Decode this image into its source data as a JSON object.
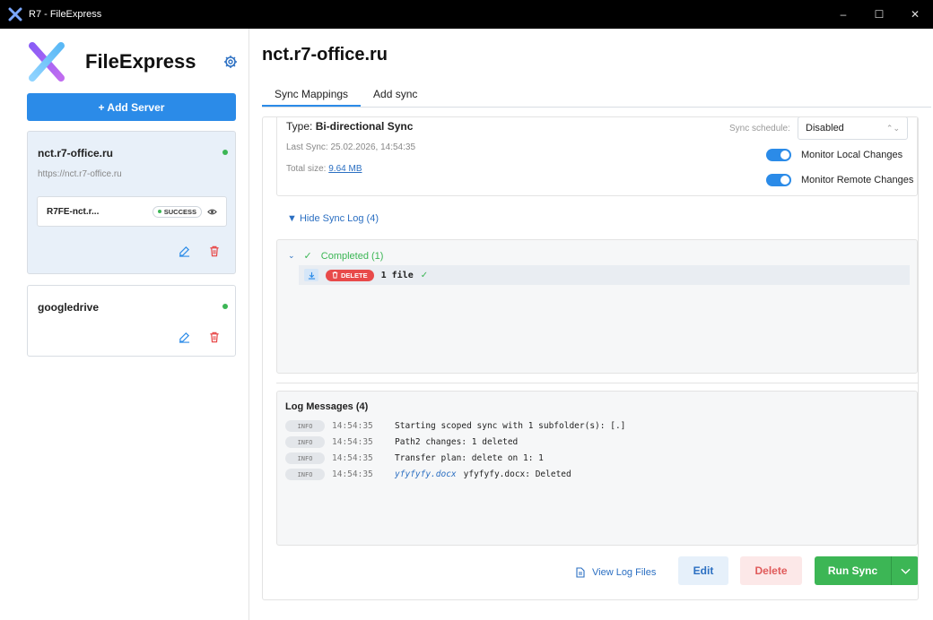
{
  "window": {
    "title": "R7 - FileExpress",
    "minimize": "–",
    "maximize": "☐",
    "close": "✕"
  },
  "sidebar": {
    "brand": "FileExpress",
    "add_server_label": "+ Add Server",
    "servers": [
      {
        "name": "nct.r7-office.ru",
        "url": "https://nct.r7-office.ru",
        "status_color": "#3cb655",
        "mapping": {
          "name": "R7FE-nct.r...",
          "status": "SUCCESS"
        }
      },
      {
        "name": "googledrive",
        "status_color": "#3cb655"
      }
    ]
  },
  "main": {
    "server_title": "nct.r7-office.ru",
    "tabs": [
      {
        "label": "Sync Mappings",
        "active": true
      },
      {
        "label": "Add sync",
        "active": false
      }
    ],
    "info": {
      "type_label": "Type: ",
      "type_value": "Bi-directional Sync",
      "last_sync": "Last Sync: 25.02.2026, 14:54:35",
      "size_label": "Total size: ",
      "size_value": "9.64 MB",
      "schedule_label": "Sync schedule:",
      "schedule_value": "Disabled",
      "monitor_local": "Monitor Local Changes",
      "monitor_remote": "Monitor Remote Changes",
      "monitor_local_on": true,
      "monitor_remote_on": true
    },
    "hide_log_label": "▼ Hide Sync Log (4)",
    "log_tree": {
      "group_label": "Completed (1)",
      "item": {
        "action": "DELETE",
        "text": "1 file"
      }
    },
    "log_messages": {
      "title": "Log Messages (4)",
      "lines": [
        {
          "level": "INFO",
          "time": "14:54:35",
          "file": "",
          "text": "Starting scoped sync with 1 subfolder(s): [.]"
        },
        {
          "level": "INFO",
          "time": "14:54:35",
          "file": "",
          "text": "Path2 changes: 1 deleted"
        },
        {
          "level": "INFO",
          "time": "14:54:35",
          "file": "",
          "text": "Transfer plan: delete on 1: 1"
        },
        {
          "level": "INFO",
          "time": "14:54:35",
          "file": "yfyfyfy.docx",
          "text": "yfyfyfy.docx: Deleted"
        }
      ]
    },
    "actions": {
      "view_logs": "View Log Files",
      "edit": "Edit",
      "delete": "Delete",
      "run_sync": "Run Sync"
    }
  },
  "colors": {
    "accent": "#2b8be8",
    "success": "#3cb655",
    "danger": "#e84a4a"
  }
}
